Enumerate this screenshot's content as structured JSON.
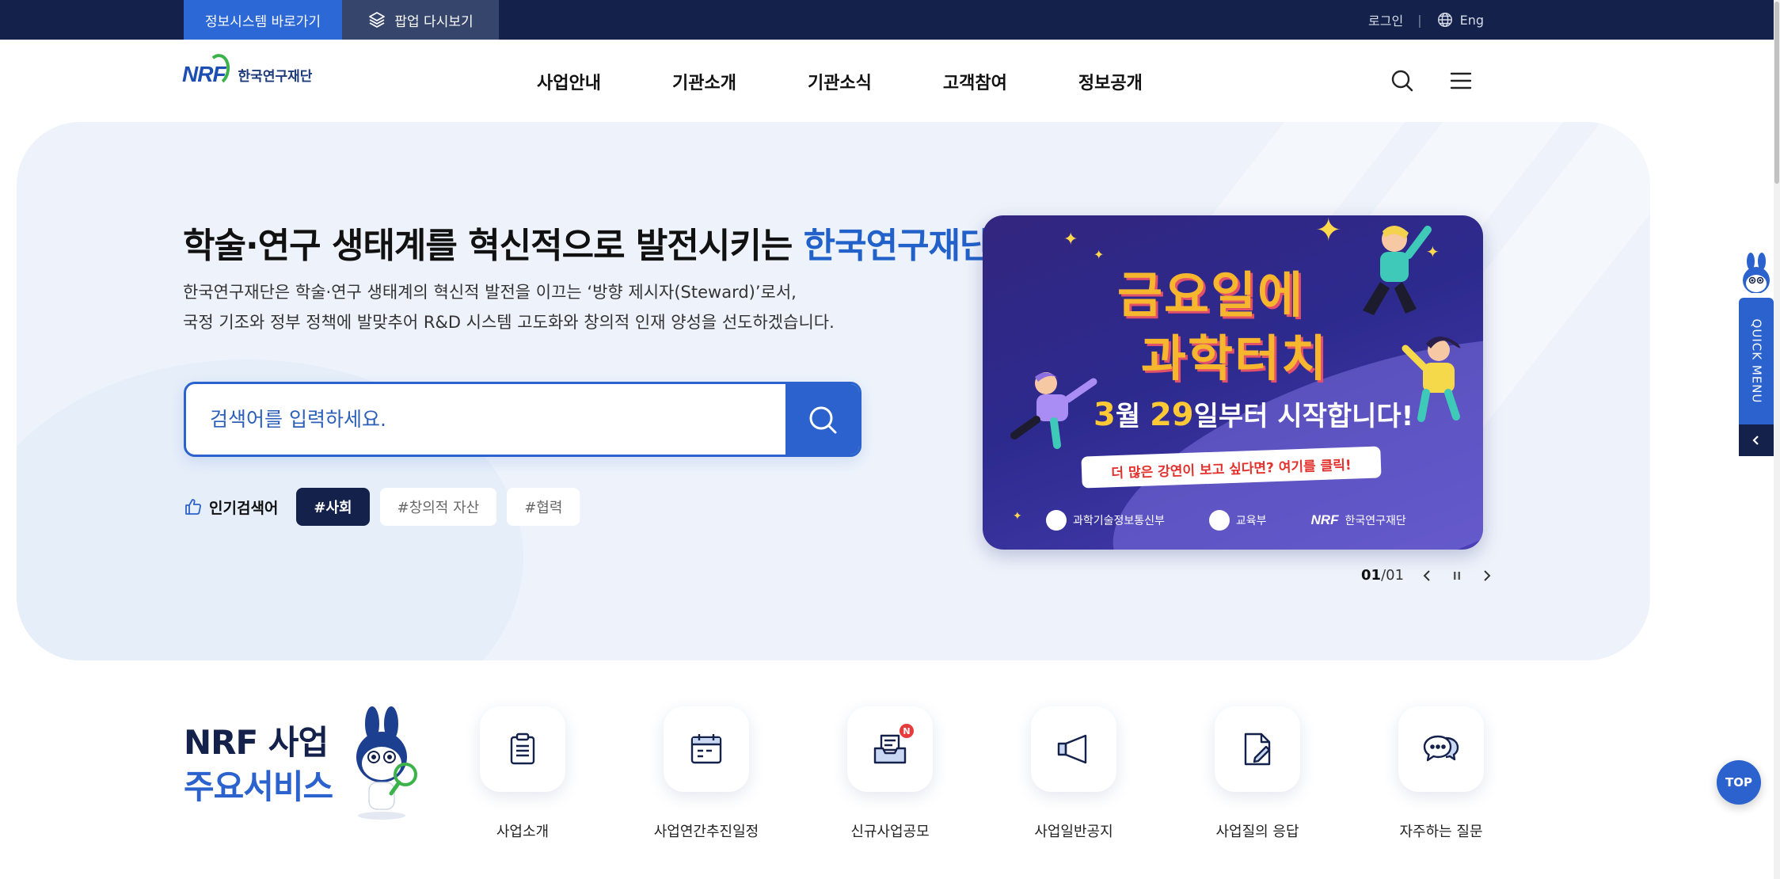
{
  "topbar": {
    "info_system_label": "정보시스템 바로가기",
    "popup_label": "팝업 다시보기",
    "login_label": "로그인",
    "separator": "|",
    "lang_label": "Eng"
  },
  "header": {
    "logo_mark": "NRF",
    "logo_text": "한국연구재단",
    "nav": [
      "사업안내",
      "기관소개",
      "기관소식",
      "고객참여",
      "정보공개"
    ]
  },
  "hero": {
    "title_prefix": "학술·연구 생태계를 혁신적으로 발전시키는 ",
    "title_highlight": "한국연구재단",
    "desc_line1": "한국연구재단은 학술·연구 생태계의 혁신적 발전을 이끄는 ‘방향 제시자(Steward)’로서,",
    "desc_line2": "국정 기조와 정부 정책에 발맞추어 R&D 시스템 고도화와 창의적 인재 양성을 선도하겠습니다.",
    "search_placeholder": "검색어를 입력하세요.",
    "popular_label": "인기검색어",
    "popular_terms": [
      "#사회",
      "#창의적 자산",
      "#협력"
    ]
  },
  "banner": {
    "title_line1": "금요일에",
    "title_line2": "과학터치",
    "date_month": "3",
    "date_month_unit": "월 ",
    "date_day": "29",
    "date_rest": "일부터 시작합니다!",
    "cta": "더 많은 강연이 보고 싶다면? 여기를 클릭!",
    "orgs": [
      "과학기술정보통신부",
      "교육부",
      "한국연구재단"
    ]
  },
  "slider": {
    "current": "01",
    "separator": "/",
    "total": "01"
  },
  "quick_menu": {
    "label": "QUICK MENU"
  },
  "services": {
    "title_line1": "NRF 사업",
    "title_line2": "주요서비스",
    "items": [
      {
        "label": "사업소개",
        "icon": "clipboard-icon"
      },
      {
        "label": "사업연간추진일정",
        "icon": "calendar-icon"
      },
      {
        "label": "신규사업공모",
        "icon": "inbox-icon",
        "badge": "N"
      },
      {
        "label": "사업일반공지",
        "icon": "megaphone-icon"
      },
      {
        "label": "사업질의 응답",
        "icon": "document-edit-icon"
      },
      {
        "label": "자주하는 질문",
        "icon": "chat-bubbles-icon"
      }
    ]
  },
  "top_button": "TOP",
  "colors": {
    "navy": "#14214a",
    "primary_blue": "#2b62cd",
    "hero_bg": "#eef3fb",
    "banner_purple": "#32267f",
    "banner_yellow": "#f6b72f"
  }
}
